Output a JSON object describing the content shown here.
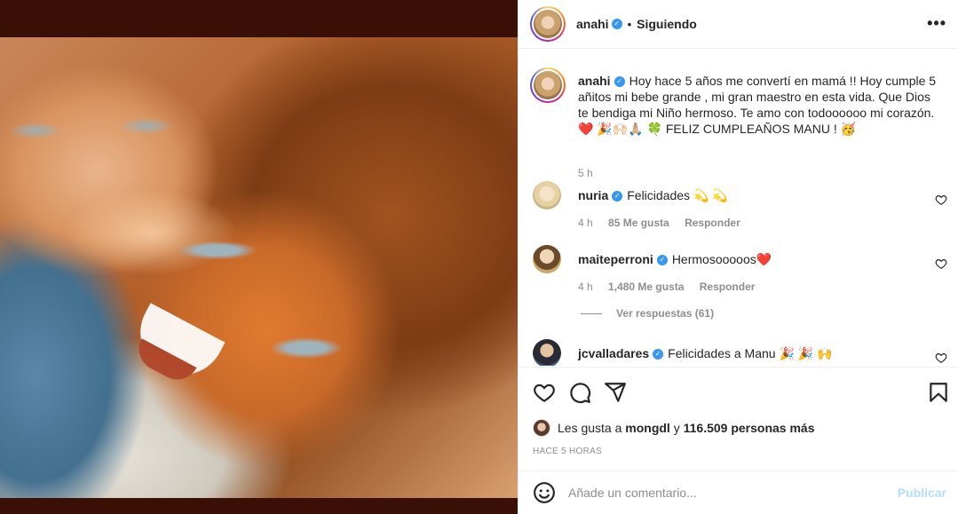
{
  "post": {
    "username": "anahi",
    "follow_status": "Siguiendo",
    "more_label": "•••",
    "caption": "Hoy hace 5 años me convertí en mamá !! Hoy cumple 5 añitos mi bebe grande , mi gran maestro en esta vida. Que Dios te bendiga mi Niño hermoso. Te amo con todoooooo mi corazón. ❤️ 🎉🙌🏻🙏🏼 🍀 FELIZ CUMPLEAÑOS MANU ! 🥳",
    "caption_time": "5 h"
  },
  "comments": [
    {
      "username": "nuria",
      "text": "Felicidades 💫 💫",
      "time": "4 h",
      "likes": "85 Me gusta",
      "reply": "Responder"
    },
    {
      "username": "maiteperroni",
      "text": "Hermosooooos❤️",
      "time": "4 h",
      "likes": "1,480 Me gusta",
      "reply": "Responder",
      "view_replies": "Ver respuestas (61)"
    },
    {
      "username": "jcvalladares",
      "text": "Felicidades a Manu 🎉 🎉 🙌"
    }
  ],
  "likes": {
    "prefix": "Les gusta a",
    "user": "mongdl",
    "connector": "y",
    "others": "116.509 personas más"
  },
  "post_age": "HACE 5 HORAS",
  "add_comment": {
    "placeholder": "Añade un comentario...",
    "publish_label": "Publicar"
  },
  "icons": {
    "like": "heart-icon",
    "comment": "comment-icon",
    "share": "share-icon",
    "save": "bookmark-icon",
    "emoji": "emoji-icon",
    "verified": "verified-badge-icon"
  },
  "colors": {
    "text": "#262626",
    "secondary": "#8e8e8e",
    "verified": "#3897f0",
    "publish_disabled": "#b2dffc"
  }
}
